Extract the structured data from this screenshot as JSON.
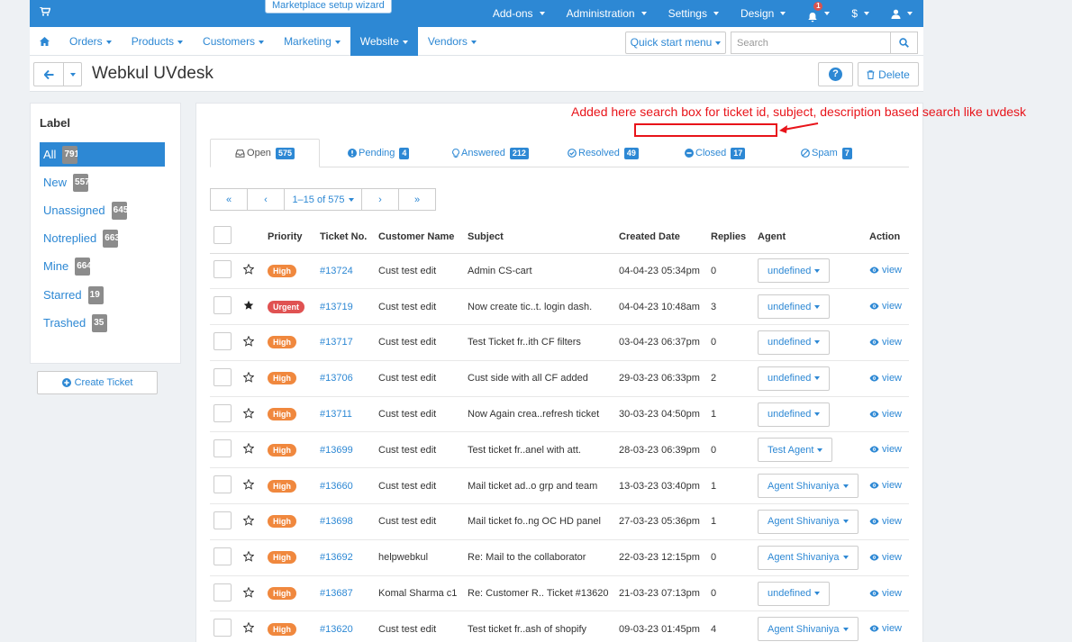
{
  "topbar": {
    "wizard_label": "Marketplace setup wizard",
    "menu": [
      {
        "label": "Add-ons"
      },
      {
        "label": "Administration"
      },
      {
        "label": "Settings"
      },
      {
        "label": "Design"
      }
    ],
    "notification_count": "1",
    "currency_label": "$"
  },
  "navbar": {
    "items": [
      {
        "label": "Orders"
      },
      {
        "label": "Products"
      },
      {
        "label": "Customers"
      },
      {
        "label": "Marketing"
      },
      {
        "label": "Website"
      },
      {
        "label": "Vendors"
      }
    ],
    "active": "Website",
    "quick_start_label": "Quick start menu",
    "search_placeholder": "Search"
  },
  "header": {
    "title": "Webkul UVdesk",
    "help_label": "?",
    "delete_label": "Delete"
  },
  "sidebar": {
    "title": "Label",
    "labels": [
      {
        "label": "All",
        "count": "791",
        "active": true
      },
      {
        "label": "New",
        "count": "557"
      },
      {
        "label": "Unassigned",
        "count": "645"
      },
      {
        "label": "Notreplied",
        "count": "663"
      },
      {
        "label": "Mine",
        "count": "664"
      },
      {
        "label": "Starred",
        "count": "19"
      },
      {
        "label": "Trashed",
        "count": "35"
      }
    ],
    "create_label": "Create Ticket"
  },
  "annotation": {
    "text": "Added here search box for ticket id, subject, description based search like uvdesk",
    "color": "#e8141a"
  },
  "tabs": [
    {
      "label": "Open",
      "count": "575",
      "icon": "inbox-icon",
      "active": true
    },
    {
      "label": "Pending",
      "count": "4",
      "icon": "exclamation-circle-icon"
    },
    {
      "label": "Answered",
      "count": "212",
      "icon": "lightbulb-icon"
    },
    {
      "label": "Resolved",
      "count": "49",
      "icon": "check-circle-icon"
    },
    {
      "label": "Closed",
      "count": "17",
      "icon": "minus-circle-icon"
    },
    {
      "label": "Spam",
      "count": "7",
      "icon": "ban-icon"
    }
  ],
  "pager": {
    "first": "«",
    "prev": "‹",
    "range": "1–15 of 575",
    "next": "›",
    "last": "»"
  },
  "table": {
    "headers": {
      "priority": "Priority",
      "ticket": "Ticket No.",
      "customer": "Customer Name",
      "subject": "Subject",
      "created": "Created Date",
      "replies": "Replies",
      "agent": "Agent",
      "action": "Action"
    },
    "view_label": "view",
    "rows": [
      {
        "starred": false,
        "priority": "High",
        "ticket": "#13724",
        "customer": "Cust test edit",
        "subject": "Admin CS-cart",
        "created": "04-04-23 05:34pm",
        "replies": "0",
        "agent": "undefined"
      },
      {
        "starred": true,
        "priority": "Urgent",
        "ticket": "#13719",
        "customer": "Cust test edit",
        "subject": "Now create tic..t. login dash.",
        "created": "04-04-23 10:48am",
        "replies": "3",
        "agent": "undefined"
      },
      {
        "starred": false,
        "priority": "High",
        "ticket": "#13717",
        "customer": "Cust test edit",
        "subject": "Test Ticket fr..ith CF filters",
        "created": "03-04-23 06:37pm",
        "replies": "0",
        "agent": "undefined"
      },
      {
        "starred": false,
        "priority": "High",
        "ticket": "#13706",
        "customer": "Cust test edit",
        "subject": "Cust side with all CF added",
        "created": "29-03-23 06:33pm",
        "replies": "2",
        "agent": "undefined"
      },
      {
        "starred": false,
        "priority": "High",
        "ticket": "#13711",
        "customer": "Cust test edit",
        "subject": "Now Again crea..refresh ticket",
        "created": "30-03-23 04:50pm",
        "replies": "1",
        "agent": "undefined"
      },
      {
        "starred": false,
        "priority": "High",
        "ticket": "#13699",
        "customer": "Cust test edit",
        "subject": "Test ticket fr..anel with att.",
        "created": "28-03-23 06:39pm",
        "replies": "0",
        "agent": "Test Agent"
      },
      {
        "starred": false,
        "priority": "High",
        "ticket": "#13660",
        "customer": "Cust test edit",
        "subject": "Mail ticket ad..o grp and team",
        "created": "13-03-23 03:40pm",
        "replies": "1",
        "agent": "Agent Shivaniya"
      },
      {
        "starred": false,
        "priority": "High",
        "ticket": "#13698",
        "customer": "Cust test edit",
        "subject": "Mail ticket fo..ng OC HD panel",
        "created": "27-03-23 05:36pm",
        "replies": "1",
        "agent": "Agent Shivaniya"
      },
      {
        "starred": false,
        "priority": "High",
        "ticket": "#13692",
        "customer": "helpwebkul",
        "subject": "Re: Mail to the collaborator",
        "created": "22-03-23 12:15pm",
        "replies": "0",
        "agent": "Agent Shivaniya"
      },
      {
        "starred": false,
        "priority": "High",
        "ticket": "#13687",
        "customer": "Komal Sharma c1",
        "subject": "Re: Customer R.. Ticket #13620",
        "created": "21-03-23 07:13pm",
        "replies": "0",
        "agent": "undefined"
      },
      {
        "starred": false,
        "priority": "High",
        "ticket": "#13620",
        "customer": "Cust test edit",
        "subject": "Test ticket fr..ash of shopify",
        "created": "09-03-23 01:45pm",
        "replies": "4",
        "agent": "Agent Shivaniya"
      }
    ]
  },
  "colors": {
    "accent": "#2d88d4",
    "high": "#f0883e",
    "urgent": "#e05252",
    "annotation": "#e8141a"
  }
}
